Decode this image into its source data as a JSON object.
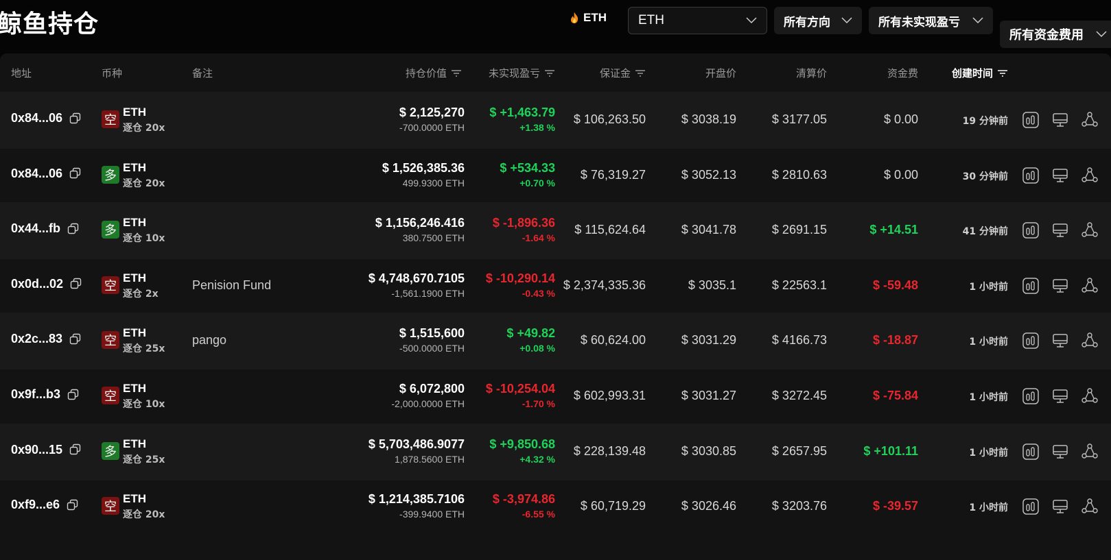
{
  "header": {
    "title": "鲸鱼持仓",
    "coin_tag": "ETH",
    "filters": {
      "coin": "ETH",
      "direction": "所有方向",
      "unrealized_pnl": "所有未实现盈亏",
      "funding_fee": "所有资金费用"
    }
  },
  "columns": {
    "address": "地址",
    "coin": "币种",
    "note": "备注",
    "position_value": "持仓价值",
    "unrealized_pnl": "未实现盈亏",
    "margin": "保证金",
    "open_price": "开盘价",
    "liq_price": "清算价",
    "funding_fee": "资金费",
    "created": "创建时间"
  },
  "colors": {
    "green": "#1fd35a",
    "red": "#e8262e",
    "short_badge": "#7a1212",
    "long_badge": "#1f7a2a"
  },
  "rows": [
    {
      "address": "0x84...06",
      "side": "空",
      "side_type": "short",
      "coin": "ETH",
      "mode": "逐仓 20x",
      "note": "",
      "value": "$ 2,125,270",
      "size": "-700.0000 ETH",
      "pnl": "$ +1,463.79",
      "pnl_pct": "+1.38 %",
      "pnl_sign": "green",
      "margin": "$ 106,263.50",
      "open": "$ 3038.19",
      "liq": "$ 3177.05",
      "fund": "$ 0.00",
      "fund_sign": "neutral",
      "time": "19 分钟前"
    },
    {
      "address": "0x84...06",
      "side": "多",
      "side_type": "long",
      "coin": "ETH",
      "mode": "逐仓 20x",
      "note": "",
      "value": "$ 1,526,385.36",
      "size": "499.9300 ETH",
      "pnl": "$ +534.33",
      "pnl_pct": "+0.70 %",
      "pnl_sign": "green",
      "margin": "$ 76,319.27",
      "open": "$ 3052.13",
      "liq": "$ 2810.63",
      "fund": "$ 0.00",
      "fund_sign": "neutral",
      "time": "30 分钟前"
    },
    {
      "address": "0x44...fb",
      "side": "多",
      "side_type": "long",
      "coin": "ETH",
      "mode": "逐仓 10x",
      "note": "",
      "value": "$ 1,156,246.416",
      "size": "380.7500 ETH",
      "pnl": "$ -1,896.36",
      "pnl_pct": "-1.64 %",
      "pnl_sign": "red",
      "margin": "$ 115,624.64",
      "open": "$ 3041.78",
      "liq": "$ 2691.15",
      "fund": "$ +14.51",
      "fund_sign": "green",
      "time": "41 分钟前"
    },
    {
      "address": "0x0d...02",
      "side": "空",
      "side_type": "short",
      "coin": "ETH",
      "mode": "逐仓 2x",
      "note": "Penision Fund",
      "value": "$ 4,748,670.7105",
      "size": "-1,561.1900 ETH",
      "pnl": "$ -10,290.14",
      "pnl_pct": "-0.43 %",
      "pnl_sign": "red",
      "margin": "$ 2,374,335.36",
      "open": "$ 3035.1",
      "liq": "$ 22563.1",
      "fund": "$ -59.48",
      "fund_sign": "red",
      "time": "1 小时前"
    },
    {
      "address": "0x2c...83",
      "side": "空",
      "side_type": "short",
      "coin": "ETH",
      "mode": "逐仓 25x",
      "note": "pango",
      "value": "$ 1,515,600",
      "size": "-500.0000 ETH",
      "pnl": "$ +49.82",
      "pnl_pct": "+0.08 %",
      "pnl_sign": "green",
      "margin": "$ 60,624.00",
      "open": "$ 3031.29",
      "liq": "$ 4166.73",
      "fund": "$ -18.87",
      "fund_sign": "red",
      "time": "1 小时前"
    },
    {
      "address": "0x9f...b3",
      "side": "空",
      "side_type": "short",
      "coin": "ETH",
      "mode": "逐仓 10x",
      "note": "",
      "value": "$ 6,072,800",
      "size": "-2,000.0000 ETH",
      "pnl": "$ -10,254.04",
      "pnl_pct": "-1.70 %",
      "pnl_sign": "red",
      "margin": "$ 602,993.31",
      "open": "$ 3031.27",
      "liq": "$ 3272.45",
      "fund": "$ -75.84",
      "fund_sign": "red",
      "time": "1 小时前"
    },
    {
      "address": "0x90...15",
      "side": "多",
      "side_type": "long",
      "coin": "ETH",
      "mode": "逐仓 25x",
      "note": "",
      "value": "$ 5,703,486.9077",
      "size": "1,878.5600 ETH",
      "pnl": "$ +9,850.68",
      "pnl_pct": "+4.32 %",
      "pnl_sign": "green",
      "margin": "$ 228,139.48",
      "open": "$ 3030.85",
      "liq": "$ 2657.95",
      "fund": "$ +101.11",
      "fund_sign": "green",
      "time": "1 小时前"
    },
    {
      "address": "0xf9...e6",
      "side": "空",
      "side_type": "short",
      "coin": "ETH",
      "mode": "逐仓 20x",
      "note": "",
      "value": "$ 1,214,385.7106",
      "size": "-399.9400 ETH",
      "pnl": "$ -3,974.86",
      "pnl_pct": "-6.55 %",
      "pnl_sign": "red",
      "margin": "$ 60,719.29",
      "open": "$ 3026.46",
      "liq": "$ 3203.76",
      "fund": "$ -39.57",
      "fund_sign": "red",
      "time": "1 小时前"
    }
  ]
}
